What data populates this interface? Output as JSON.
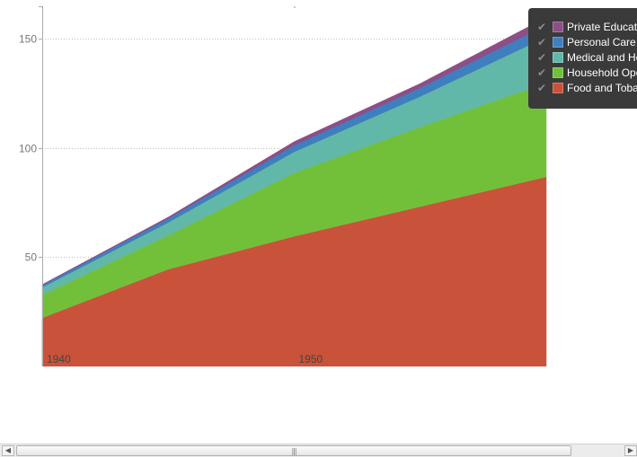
{
  "chart_data": {
    "type": "area",
    "stacked": true,
    "x": [
      1940,
      1945,
      1950,
      1955,
      1960
    ],
    "x_ticks": [
      "1940",
      "1950"
    ],
    "y_ticks": [
      "50",
      "100",
      "150"
    ],
    "ylim": [
      0,
      165
    ],
    "xlim": [
      1940,
      1960
    ],
    "grid": "horizontal dotted",
    "legend_position": "top-right",
    "series": [
      {
        "name": "Food and Tobacco",
        "color": "#c9523a",
        "values": [
          22.2,
          44.5,
          59.6,
          73.2,
          86.8
        ]
      },
      {
        "name": "Household Operation",
        "color": "#72c03a",
        "values": [
          10.5,
          15.5,
          29.0,
          36.5,
          43.0
        ]
      },
      {
        "name": "Medical and Health",
        "color": "#62b8a8",
        "values": [
          3.5,
          5.9,
          9.7,
          14.0,
          21.1
        ]
      },
      {
        "name": "Personal Care",
        "color": "#3f7fbf",
        "values": [
          1.0,
          1.9,
          3.0,
          4.0,
          5.4
        ]
      },
      {
        "name": "Private Education",
        "color": "#8d4f85",
        "values": [
          0.3,
          0.6,
          1.7,
          1.9,
          3.6
        ]
      }
    ]
  },
  "legend": {
    "items": [
      {
        "label": "Private Education",
        "color": "#8d4f85"
      },
      {
        "label": "Personal Care",
        "color": "#3f7fbf"
      },
      {
        "label": "Medical and Health",
        "color": "#62b8a8"
      },
      {
        "label": "Household Operation",
        "color": "#72c03a"
      },
      {
        "label": "Food and Tobacco",
        "color": "#c9523a"
      }
    ],
    "check_glyph": "✔"
  },
  "scrollbar": {
    "left_arrow": "◀",
    "right_arrow": "▶",
    "grip": "|||"
  }
}
